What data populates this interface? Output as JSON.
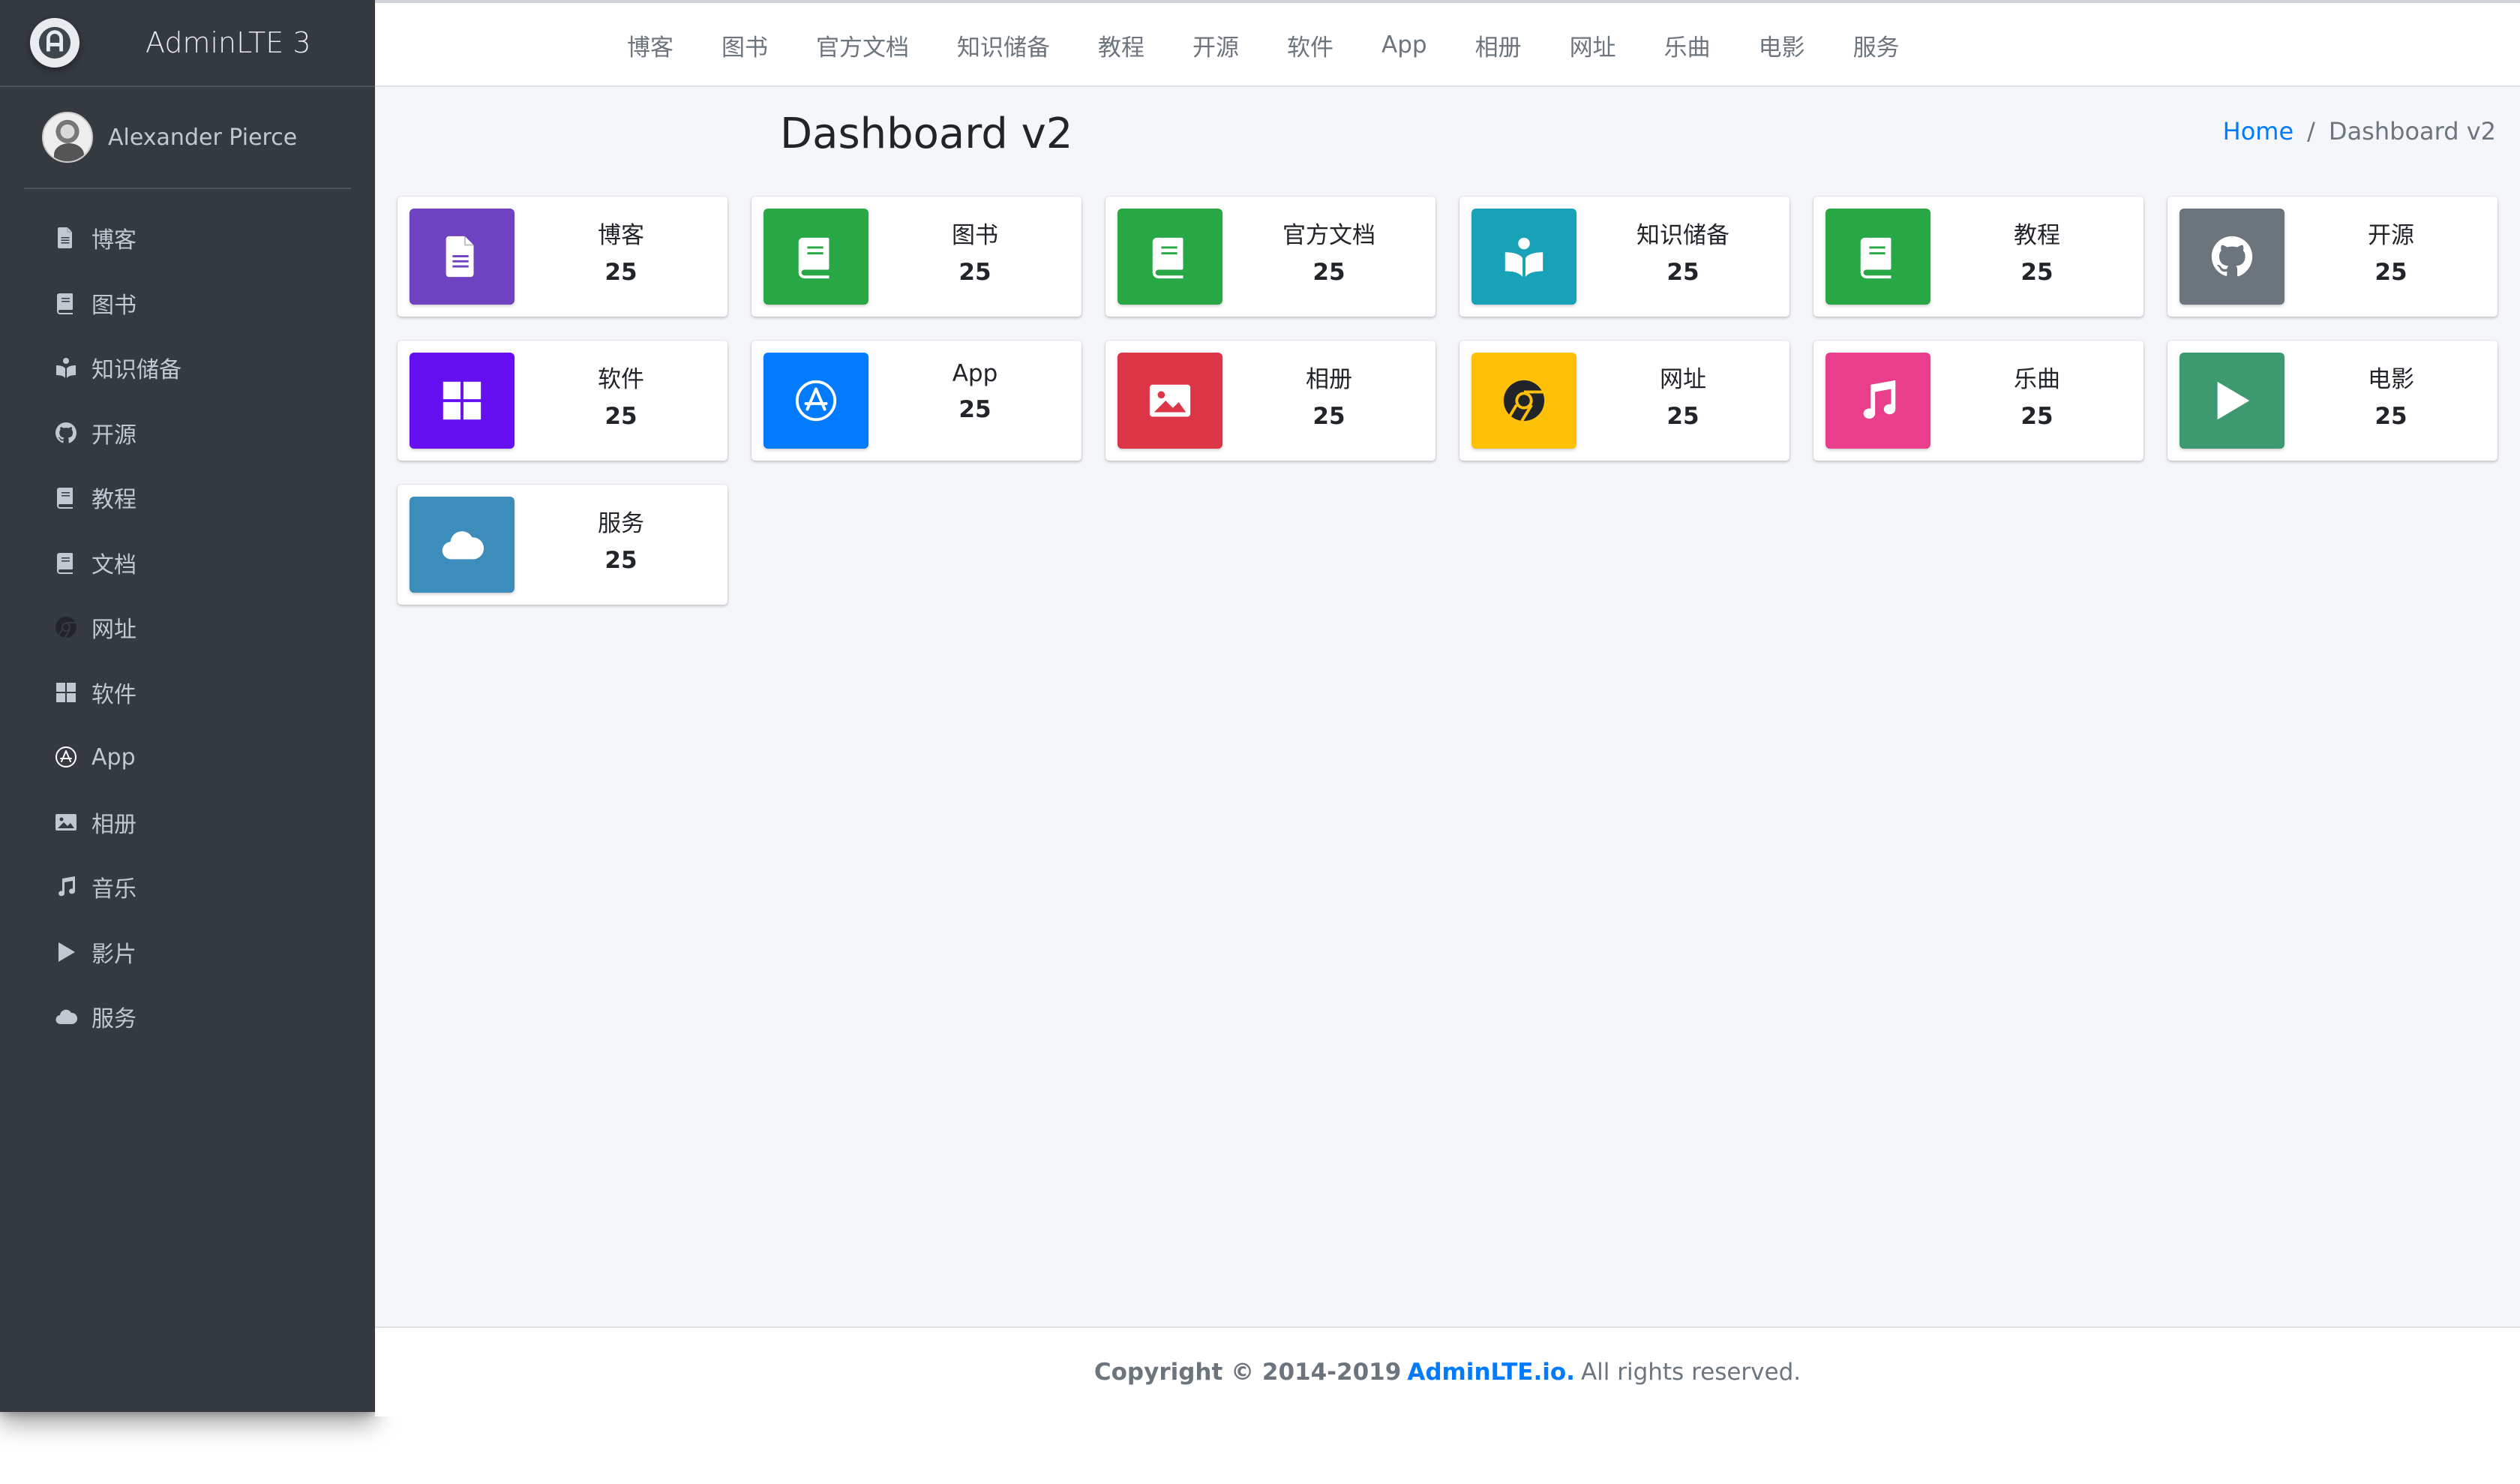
{
  "brand": {
    "name": "AdminLTE 3"
  },
  "user": {
    "name": "Alexander Pierce"
  },
  "sidebar": {
    "items": [
      {
        "label": "博客",
        "icon": "file-icon"
      },
      {
        "label": "图书",
        "icon": "book-icon"
      },
      {
        "label": "知识储备",
        "icon": "reader-icon"
      },
      {
        "label": "开源",
        "icon": "github-icon"
      },
      {
        "label": "教程",
        "icon": "book-icon"
      },
      {
        "label": "文档",
        "icon": "book-icon"
      },
      {
        "label": "网址",
        "icon": "chrome-icon"
      },
      {
        "label": "软件",
        "icon": "windows-icon"
      },
      {
        "label": "App",
        "icon": "app-store-icon"
      },
      {
        "label": "相册",
        "icon": "image-icon"
      },
      {
        "label": "音乐",
        "icon": "music-icon"
      },
      {
        "label": "影片",
        "icon": "play-icon"
      },
      {
        "label": "服务",
        "icon": "cloud-icon"
      }
    ]
  },
  "topnav": {
    "links": [
      "博客",
      "图书",
      "官方文档",
      "知识储备",
      "教程",
      "开源",
      "软件",
      "App",
      "相册",
      "网址",
      "乐曲",
      "电影",
      "服务"
    ]
  },
  "page": {
    "title": "Dashboard v2",
    "breadcrumb": {
      "home": "Home",
      "separator": "/",
      "current": "Dashboard v2"
    }
  },
  "cards": [
    {
      "label": "博客",
      "count": "25",
      "icon": "file-icon",
      "color": "#6f42c1"
    },
    {
      "label": "图书",
      "count": "25",
      "icon": "book-icon",
      "color": "#28a745"
    },
    {
      "label": "官方文档",
      "count": "25",
      "icon": "book-icon",
      "color": "#28a745"
    },
    {
      "label": "知识储备",
      "count": "25",
      "icon": "reader-icon",
      "color": "#17a2b8"
    },
    {
      "label": "教程",
      "count": "25",
      "icon": "book-icon",
      "color": "#28a745"
    },
    {
      "label": "开源",
      "count": "25",
      "icon": "github-icon",
      "color": "#6c757d"
    },
    {
      "label": "软件",
      "count": "25",
      "icon": "windows-icon",
      "color": "#6610f2"
    },
    {
      "label": "App",
      "count": "25",
      "icon": "app-store-icon",
      "color": "#007bff"
    },
    {
      "label": "相册",
      "count": "25",
      "icon": "image-icon",
      "color": "#dc3545"
    },
    {
      "label": "网址",
      "count": "25",
      "icon": "chrome-icon",
      "color": "#ffc107"
    },
    {
      "label": "乐曲",
      "count": "25",
      "icon": "music-icon",
      "color": "#e83e8c"
    },
    {
      "label": "电影",
      "count": "25",
      "icon": "play-icon",
      "color": "#3d9970"
    },
    {
      "label": "服务",
      "count": "25",
      "icon": "cloud-icon",
      "color": "#3c8dbc"
    }
  ],
  "footer": {
    "copyright": "Copyright © 2014-2019",
    "link": "AdminLTE.io.",
    "rights": "All rights reserved."
  },
  "colors": {
    "sidebar_bg": "#343a40",
    "content_bg": "#f4f6f9",
    "accent": "#007bff"
  }
}
